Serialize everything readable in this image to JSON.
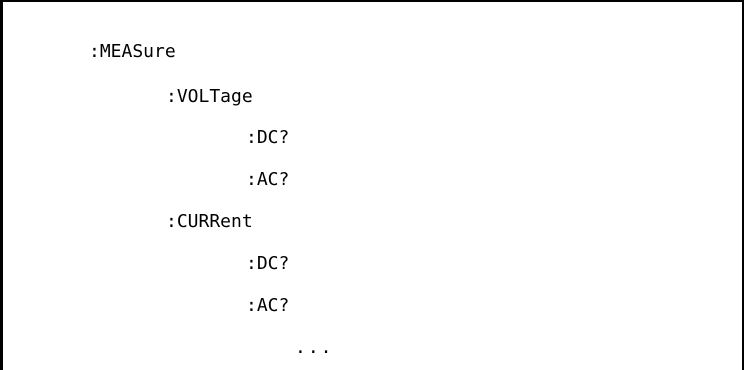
{
  "command_tree": {
    "root": ":MEASure",
    "voltage": {
      "label": ":VOLTage",
      "dc": ":DC?",
      "ac": ":AC?"
    },
    "current": {
      "label": ":CURRent",
      "dc": ":DC?",
      "ac": ":AC?"
    },
    "ellipsis": "..."
  }
}
